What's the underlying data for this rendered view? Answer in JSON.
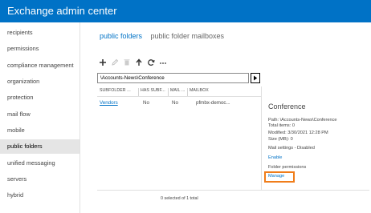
{
  "header": {
    "title": "Exchange admin center",
    "bg_color": "#0072c6"
  },
  "nav": {
    "items": [
      {
        "label": "recipients",
        "selected": false
      },
      {
        "label": "permissions",
        "selected": false
      },
      {
        "label": "compliance management",
        "selected": false
      },
      {
        "label": "organization",
        "selected": false
      },
      {
        "label": "protection",
        "selected": false
      },
      {
        "label": "mail flow",
        "selected": false
      },
      {
        "label": "mobile",
        "selected": false
      },
      {
        "label": "public folders",
        "selected": true
      },
      {
        "label": "unified messaging",
        "selected": false
      },
      {
        "label": "servers",
        "selected": false
      },
      {
        "label": "hybrid",
        "selected": false
      }
    ]
  },
  "tabs": [
    {
      "label": "public folders",
      "active": true
    },
    {
      "label": "public folder mailboxes",
      "active": false
    }
  ],
  "toolbar": {
    "icons": [
      "add-icon",
      "edit-icon",
      "delete-icon",
      "up-icon",
      "refresh-icon",
      "more-icon"
    ],
    "more_label": "..."
  },
  "path": {
    "value": "\\Accounts-News\\Conference"
  },
  "grid": {
    "columns": [
      "SUBFOLDER ...",
      "HAS SUBF...",
      "MAIL ...",
      "MAILBOX"
    ],
    "rows": [
      {
        "name": "Vendors",
        "has_subfolders": "No",
        "mail_enabled": "No",
        "mailbox": "pfmbx-democ..."
      }
    ],
    "status": "0 selected of 1 total"
  },
  "details": {
    "title": "Conference",
    "path": "Path: \\Accounts-News\\Conference",
    "total_items": "Total items: 0",
    "modified": "Modified: 3/30/2021 12:28 PM",
    "size": "Size (MB): 0",
    "mail_settings": "Mail settings - Disabled",
    "enable_link": "Enable",
    "folder_permissions": "Folder permissions",
    "manage_link": "Manage",
    "highlight_color": "#f07d1a"
  }
}
